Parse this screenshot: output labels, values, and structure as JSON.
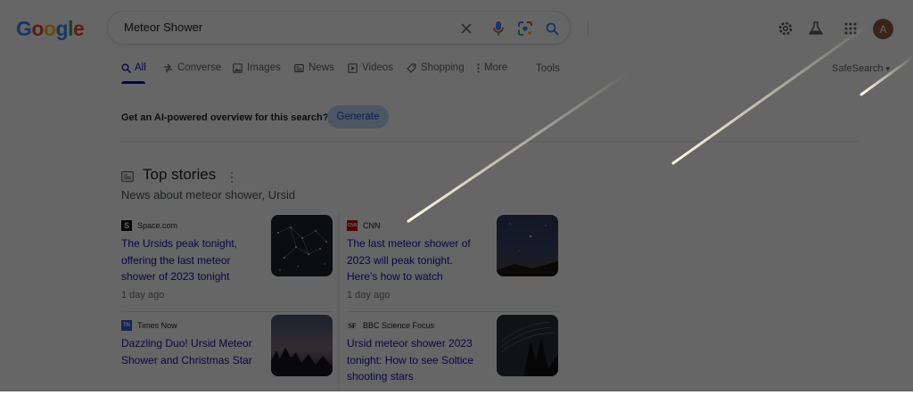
{
  "logo": {
    "text": "Google",
    "letters": [
      {
        "ch": "G",
        "color": "#4285F4"
      },
      {
        "ch": "o",
        "color": "#EA4335"
      },
      {
        "ch": "o",
        "color": "#FBBC05"
      },
      {
        "ch": "g",
        "color": "#4285F4"
      },
      {
        "ch": "l",
        "color": "#34A853"
      },
      {
        "ch": "e",
        "color": "#EA4335"
      }
    ]
  },
  "search": {
    "query": "Meteor Shower",
    "icons": [
      "clear-icon",
      "mic-icon",
      "lens-icon",
      "search-icon"
    ]
  },
  "header_right": {
    "icons": [
      "settings-icon",
      "labs-icon",
      "apps-icon"
    ],
    "avatar_letter": "A"
  },
  "tabs": [
    {
      "label": "All",
      "icon": "search-icon",
      "active": true
    },
    {
      "label": "Converse",
      "icon": "converse-icon"
    },
    {
      "label": "Images",
      "icon": "images-icon"
    },
    {
      "label": "News",
      "icon": "news-icon"
    },
    {
      "label": "Videos",
      "icon": "videos-icon"
    },
    {
      "label": "Shopping",
      "icon": "shopping-icon"
    },
    {
      "label": "More",
      "icon": "more-dots-icon"
    }
  ],
  "tools_label": "Tools",
  "safesearch_label": "SafeSearch",
  "ai_overview": {
    "text": "Get an AI-powered overview for this search?",
    "button": "Generate"
  },
  "top_stories": {
    "title": "Top stories",
    "subtitle": "News about meteor shower, Ursid",
    "cards": [
      {
        "source": "Space.com",
        "favicon": "S",
        "favicon_color": "#111111",
        "headline": "The Ursids peak tonight, offering the last meteor shower of 2023 tonight",
        "age": "1 day ago",
        "thumb": "constellation"
      },
      {
        "source": "CNN",
        "favicon": "CNN",
        "favicon_color": "#cc0000",
        "headline": "The last meteor shower of 2023 will peak tonight. Here's how to watch",
        "age": "1 day ago",
        "thumb": "night-sky"
      },
      {
        "source": "Times Now",
        "favicon": "TN",
        "favicon_color": "#3b5bdb",
        "headline": "Dazzling Duo! Ursid Meteor Shower and Christmas Star",
        "age": "",
        "thumb": "dusk-trees"
      },
      {
        "source": "BBC Science Focus",
        "favicon": "SF",
        "favicon_color": "#111111",
        "headline": "Ursid meteor shower 2023 tonight: How to see Soltice shooting stars",
        "age": "",
        "thumb": "star-trails"
      }
    ]
  }
}
